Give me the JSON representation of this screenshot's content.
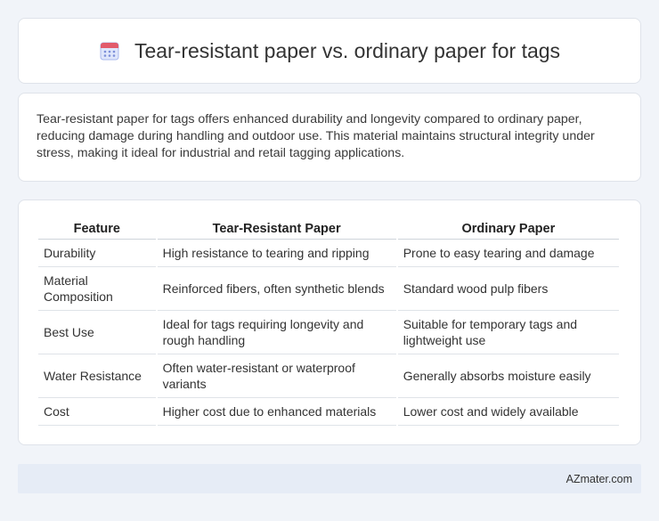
{
  "header": {
    "title": "Tear-resistant paper vs. ordinary paper for tags",
    "icon": "calendar-icon"
  },
  "intro": {
    "text": "Tear-resistant paper for tags offers enhanced durability and longevity compared to ordinary paper, reducing damage during handling and outdoor use. This material maintains structural integrity under stress, making it ideal for industrial and retail tagging applications."
  },
  "table": {
    "headers": [
      "Feature",
      "Tear-Resistant Paper",
      "Ordinary Paper"
    ],
    "rows": [
      [
        "Durability",
        "High resistance to tearing and ripping",
        "Prone to easy tearing and damage"
      ],
      [
        "Material Composition",
        "Reinforced fibers, often synthetic blends",
        "Standard wood pulp fibers"
      ],
      [
        "Best Use",
        "Ideal for tags requiring longevity and rough handling",
        "Suitable for temporary tags and lightweight use"
      ],
      [
        "Water Resistance",
        "Often water-resistant or waterproof variants",
        "Generally absorbs moisture easily"
      ],
      [
        "Cost",
        "Higher cost due to enhanced materials",
        "Lower cost and widely available"
      ]
    ]
  },
  "footer": {
    "brand": "AZmater.com"
  }
}
